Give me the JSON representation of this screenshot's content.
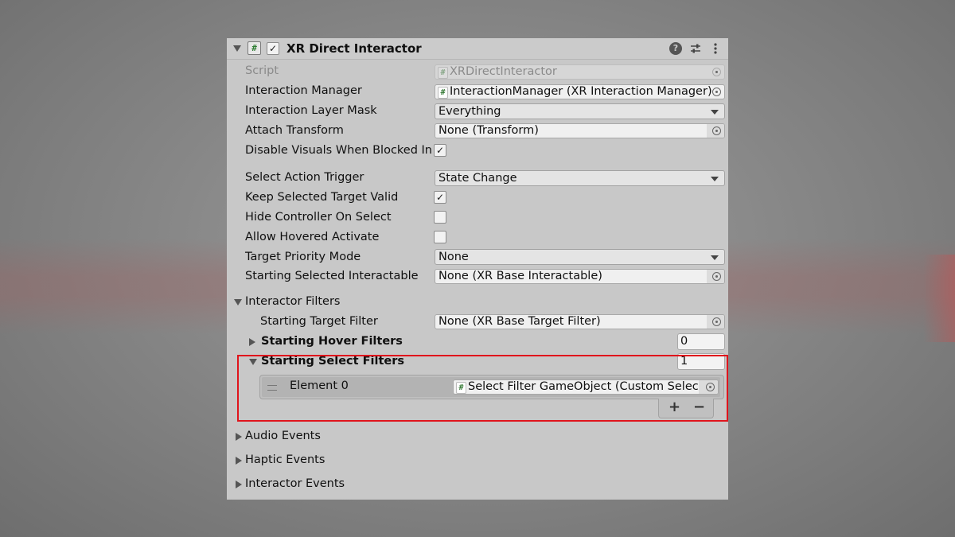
{
  "component": {
    "title": "XR Direct Interactor",
    "enabled": true
  },
  "fields": {
    "script": {
      "label": "Script",
      "value": "XRDirectInteractor"
    },
    "interaction_manager": {
      "label": "Interaction Manager",
      "value": "InteractionManager (XR Interaction Manager)"
    },
    "interaction_layer_mask": {
      "label": "Interaction Layer Mask",
      "value": "Everything"
    },
    "attach_transform": {
      "label": "Attach Transform",
      "value": "None (Transform)"
    },
    "disable_visuals": {
      "label": "Disable Visuals When Blocked In",
      "checked": true
    },
    "select_action_trigger": {
      "label": "Select Action Trigger",
      "value": "State Change"
    },
    "keep_selected_target_valid": {
      "label": "Keep Selected Target Valid",
      "checked": true
    },
    "hide_controller_on_select": {
      "label": "Hide Controller On Select",
      "checked": false
    },
    "allow_hovered_activate": {
      "label": "Allow Hovered Activate",
      "checked": false
    },
    "target_priority_mode": {
      "label": "Target Priority Mode",
      "value": "None"
    },
    "starting_selected_interactable": {
      "label": "Starting Selected Interactable",
      "value": "None (XR Base Interactable)"
    }
  },
  "filters": {
    "section_label": "Interactor Filters",
    "starting_target_filter": {
      "label": "Starting Target Filter",
      "value": "None (XR Base Target Filter)"
    },
    "hover_filters": {
      "label": "Starting Hover Filters",
      "count": "0"
    },
    "select_filters": {
      "label": "Starting Select Filters",
      "count": "1",
      "elements": [
        {
          "label": "Element 0",
          "value": "Select Filter GameObject (Custom Select"
        }
      ],
      "add_label": "+",
      "remove_label": "−"
    }
  },
  "sections": {
    "audio_events": "Audio Events",
    "haptic_events": "Haptic Events",
    "interactor_events": "Interactor Events"
  },
  "icons": {
    "header": [
      "collapse-triangle-icon",
      "script-hash-icon",
      "enabled-checkbox",
      "help-icon",
      "preset-sliders-icon",
      "kebab-menu-icon"
    ]
  },
  "colors": {
    "highlight": "#e0141c",
    "panel": "#c8c8c8"
  }
}
